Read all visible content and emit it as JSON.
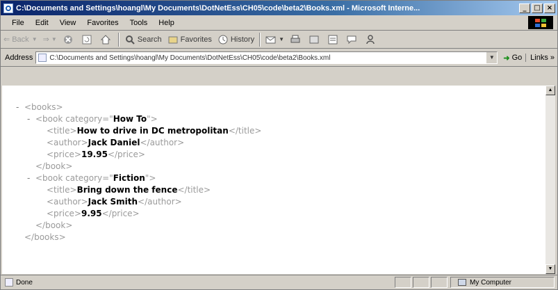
{
  "window": {
    "title": "C:\\Documents and Settings\\hoangl\\My Documents\\DotNetEss\\CH05\\code\\beta2\\Books.xml - Microsoft Interne...",
    "controls": {
      "minimize": "_",
      "maximize": "□",
      "close": "×"
    }
  },
  "menu": [
    {
      "label": "File"
    },
    {
      "label": "Edit"
    },
    {
      "label": "View"
    },
    {
      "label": "Favorites"
    },
    {
      "label": "Tools"
    },
    {
      "label": "Help"
    }
  ],
  "toolbar": {
    "back": "Back",
    "search": "Search",
    "favorites": "Favorites",
    "history": "History"
  },
  "address": {
    "label": "Address",
    "value": "C:\\Documents and Settings\\hoangl\\My Documents\\DotNetEss\\CH05\\code\\beta2\\Books.xml",
    "go": "Go",
    "links": "Links »"
  },
  "xml_lines": [
    {
      "indent": 0,
      "minus": "-",
      "open": "<books>",
      "value": "",
      "close": ""
    },
    {
      "indent": 1,
      "minus": "-",
      "open": "<book category=\"",
      "value": "How To",
      "close": "\">"
    },
    {
      "indent": 2,
      "minus": "",
      "open": "<title>",
      "value": "How to drive in DC metropolitan",
      "close": "</title>"
    },
    {
      "indent": 2,
      "minus": "",
      "open": "<author>",
      "value": "Jack Daniel",
      "close": "</author>"
    },
    {
      "indent": 2,
      "minus": "",
      "open": "<price>",
      "value": "19.95",
      "close": "</price>"
    },
    {
      "indent": 1,
      "minus": "",
      "open": "</book>",
      "value": "",
      "close": ""
    },
    {
      "indent": 1,
      "minus": "-",
      "open": "<book category=\"",
      "value": "Fiction",
      "close": "\">"
    },
    {
      "indent": 2,
      "minus": "",
      "open": "<title>",
      "value": "Bring down the fence",
      "close": "</title>"
    },
    {
      "indent": 2,
      "minus": "",
      "open": "<author>",
      "value": "Jack Smith",
      "close": "</author>"
    },
    {
      "indent": 2,
      "minus": "",
      "open": "<price>",
      "value": "9.95",
      "close": "</price>"
    },
    {
      "indent": 1,
      "minus": "",
      "open": "</book>",
      "value": "",
      "close": ""
    },
    {
      "indent": 0,
      "minus": "",
      "open": "</books>",
      "value": "",
      "close": ""
    }
  ],
  "status": {
    "text": "Done",
    "zone": "My Computer"
  },
  "icons": {
    "app": "ie-icon",
    "throbber": "windows-logo-icon"
  }
}
